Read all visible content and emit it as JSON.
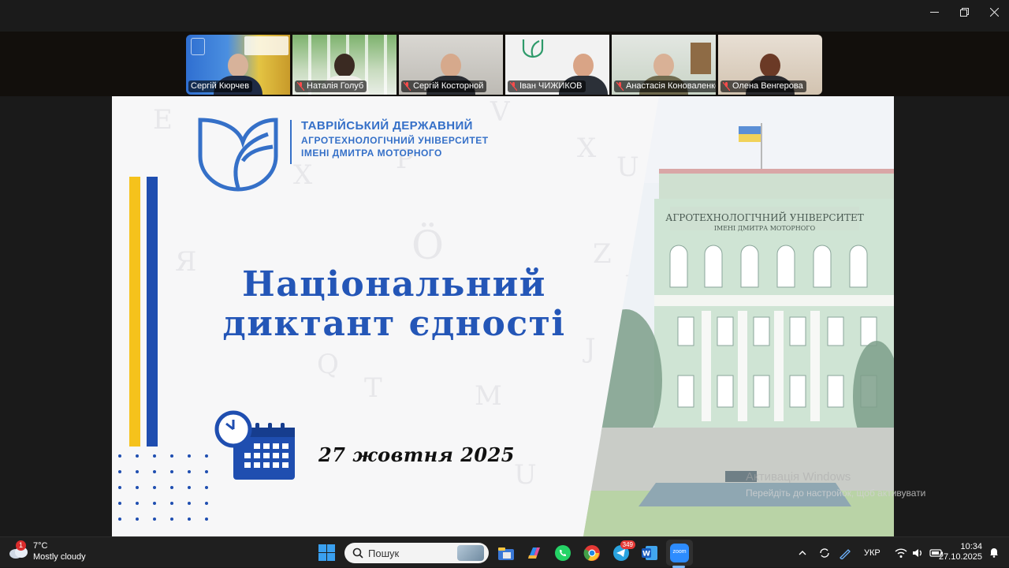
{
  "participants": [
    {
      "name": "Сергій Кюрчев",
      "muted": false
    },
    {
      "name": "Наталія Голуб",
      "muted": true
    },
    {
      "name": "Сергій Косторной",
      "muted": true
    },
    {
      "name": "Іван ЧИЖИКОВ",
      "muted": true
    },
    {
      "name": "Анастасія Коноваленко",
      "muted": true
    },
    {
      "name": "Олена Венгерова",
      "muted": true
    }
  ],
  "slide": {
    "university_line1": "ТАВРІЙСЬКИЙ ДЕРЖАВНИЙ",
    "university_line2": "АГРОТЕХНОЛОГІЧНИЙ УНІВЕРСИТЕТ",
    "university_line3": "ІМЕНІ ДМИТРА МОТОРНОГО",
    "title_line1": "Національний",
    "title_line2": "диктант єдності",
    "date": "27 жовтня 2025",
    "building_sign_line1": "АГРОТЕХНОЛОГІЧНИЙ УНІВЕРСИТЕТ",
    "building_sign_line2": "ІМЕНІ ДМИТРА МОТОРНОГО"
  },
  "watermark": {
    "line1": "Активація Windows",
    "line2": "Перейдіть до настройок, щоб активувати"
  },
  "taskbar": {
    "weather_temp": "7°C",
    "weather_desc": "Mostly cloudy",
    "weather_badge": "1",
    "search_label": "Пошук",
    "telegram_badge": "349",
    "zoom_label": "zoom",
    "language": "УКР",
    "time": "10:34",
    "date": "27.10.2025"
  },
  "colors": {
    "brand_blue": "#2456b7",
    "flag_yellow": "#f5c21c",
    "flag_blue": "#1f4eb0"
  }
}
